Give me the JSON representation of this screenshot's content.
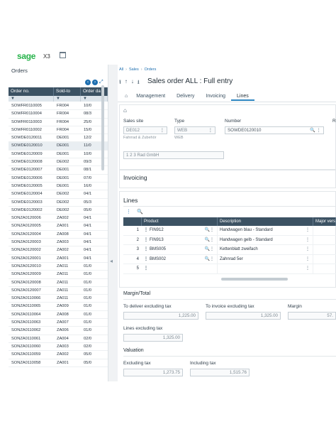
{
  "brand": {
    "logo": "sage",
    "product": "X3"
  },
  "left": {
    "title": "Orders",
    "columns": [
      "Order no.",
      "Sold-to",
      "Order da"
    ],
    "rows": [
      [
        "SOWFR0110005",
        "FR004",
        "10/0"
      ],
      [
        "SOWFR0110004",
        "FR004",
        "08/3"
      ],
      [
        "SOWFR0110003",
        "FR004",
        "25/0"
      ],
      [
        "SOWFR0110002",
        "FR004",
        "15/0"
      ],
      [
        "SOWDE0120011",
        "DE001",
        "12/2"
      ],
      [
        "SOWDE0120010",
        "DE001",
        "11/0"
      ],
      [
        "SOWDE0120009",
        "DE001",
        "10/0"
      ],
      [
        "SOWDE0120008",
        "DE002",
        "09/3"
      ],
      [
        "SOWDE0120007",
        "DE001",
        "08/1"
      ],
      [
        "SOWDE0120006",
        "DE001",
        "07/0"
      ],
      [
        "SOWDE0120005",
        "DE001",
        "16/0"
      ],
      [
        "SOWDE0120004",
        "DE002",
        "04/1"
      ],
      [
        "SOWDE0120003",
        "DE002",
        "05/3"
      ],
      [
        "SOWDE0120002",
        "DE002",
        "05/0"
      ],
      [
        "SONZA0120006",
        "ZA002",
        "04/1"
      ],
      [
        "SONZA0120005",
        "ZA001",
        "04/1"
      ],
      [
        "SONZA0120004",
        "ZA008",
        "04/1"
      ],
      [
        "SONZA0120003",
        "ZA003",
        "04/1"
      ],
      [
        "SONZA0120002",
        "ZA002",
        "04/1"
      ],
      [
        "SONZA0120001",
        "ZA001",
        "04/1"
      ],
      [
        "SONZA0120010",
        "ZA011",
        "01/0"
      ],
      [
        "SONZA0120009",
        "ZA011",
        "01/0"
      ],
      [
        "SONZA0120008",
        "ZA011",
        "01/0"
      ],
      [
        "SONZA0120007",
        "ZA011",
        "01/0"
      ],
      [
        "SONZA0110066",
        "ZA011",
        "01/0"
      ],
      [
        "SONZA0110065",
        "ZA009",
        "01/0"
      ],
      [
        "SONZA0110064",
        "ZA008",
        "01/0"
      ],
      [
        "SONZA0110063",
        "ZA007",
        "01/0"
      ],
      [
        "SONZA0110062",
        "ZA006",
        "01/0"
      ],
      [
        "SONZA0110061",
        "ZA004",
        "02/0"
      ],
      [
        "SONZA0110060",
        "ZA003",
        "02/0"
      ],
      [
        "SONZA0110059",
        "ZA002",
        "05/0"
      ],
      [
        "SONZA0110058",
        "ZA001",
        "05/0"
      ]
    ]
  },
  "main": {
    "breadcrumb": [
      "All",
      "Sales",
      "Orders"
    ],
    "title": "Sales order ALL : Full entry",
    "tabs": [
      "Management",
      "Delivery",
      "Invoicing",
      "Lines"
    ],
    "header": {
      "sales_site_label": "Sales site",
      "sales_site_value": "DE012",
      "sales_site_hint": "Fahrrad & Zubehör",
      "type_label": "Type",
      "type_value": "WEB",
      "type_hint": "WEB",
      "number_label": "Number",
      "number_value": "SOWDE0120010",
      "extra_label": "R",
      "customer_name": "1 2 3 Rad GmbH"
    },
    "invoicing_title": "Invoicing",
    "lines_title": "Lines",
    "grid": {
      "columns": [
        "Product",
        "Description",
        "Major vers"
      ],
      "rows": [
        {
          "n": "1",
          "product": "FIN912",
          "desc": "Handwagen blau - Standard"
        },
        {
          "n": "2",
          "product": "FIN913",
          "desc": "Handwagen gelb - Standard"
        },
        {
          "n": "3",
          "product": "BMS005",
          "desc": "Kettenblatt zweifach"
        },
        {
          "n": "4",
          "product": "BMS002",
          "desc": "Zahnrad 5er"
        },
        {
          "n": "5",
          "product": "",
          "desc": ""
        }
      ]
    },
    "margin": {
      "title": "Margin/Total",
      "deliver_label": "To deliver excluding tax",
      "deliver_value": "1,225.00",
      "invoice_label": "To invoice excluding tax",
      "invoice_value": "1,325.00",
      "margin_label": "Margin",
      "margin_value": "57.",
      "lines_label": "Lines excluding tax",
      "lines_value": "1,325.00"
    },
    "valuation": {
      "title": "Valuation",
      "excl_label": "Excluding tax",
      "excl_value": "1,273.75",
      "incl_label": "Including tax",
      "incl_value": "1,515.76"
    }
  }
}
